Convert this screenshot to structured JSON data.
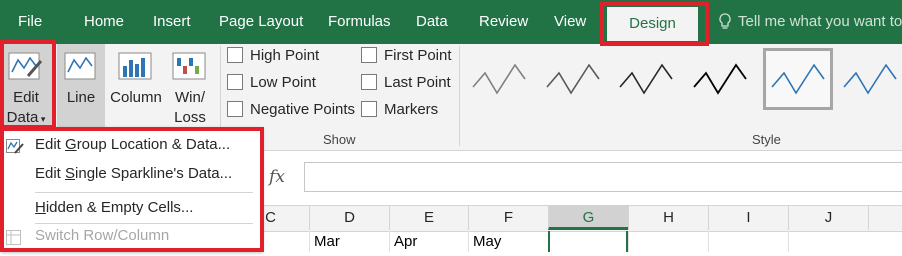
{
  "tabs": {
    "file": "File",
    "home": "Home",
    "insert": "Insert",
    "page_layout": "Page Layout",
    "formulas": "Formulas",
    "data": "Data",
    "review": "Review",
    "view": "View",
    "design": "Design"
  },
  "tell_me": {
    "icon": "lightbulb-icon",
    "text": "Tell me what you want to"
  },
  "ribbon": {
    "edit_data": {
      "line1": "Edit",
      "line2": "Data"
    },
    "type": {
      "line": "Line",
      "column": "Column",
      "winloss_1": "Win/",
      "winloss_2": "Loss"
    },
    "show": {
      "label": "Show",
      "high_point": "High Point",
      "low_point": "Low Point",
      "negative_points": "Negative Points",
      "first_point": "First Point",
      "last_point": "Last Point",
      "markers": "Markers"
    },
    "style": {
      "label": "Style"
    }
  },
  "formula_bar": {
    "fx": "fx",
    "value": ""
  },
  "columns": [
    "C",
    "D",
    "E",
    "F",
    "G",
    "H",
    "I",
    "J"
  ],
  "row_cells": {
    "d": "Mar",
    "e": "Apr",
    "f": "May"
  },
  "menu": {
    "edit_group_pre": "Edit ",
    "edit_group_ul": "G",
    "edit_group_post": "roup Location & Data...",
    "edit_single_pre": "Edit ",
    "edit_single_ul": "S",
    "edit_single_post": "ingle Sparkline's Data...",
    "hidden_ul": "H",
    "hidden_post": "idden & Empty Cells...",
    "switch": "Switch Row/Column"
  },
  "colors": {
    "accent": "#217346",
    "highlight": "#e0202b",
    "sparkline_blue": "#2e75b6"
  }
}
